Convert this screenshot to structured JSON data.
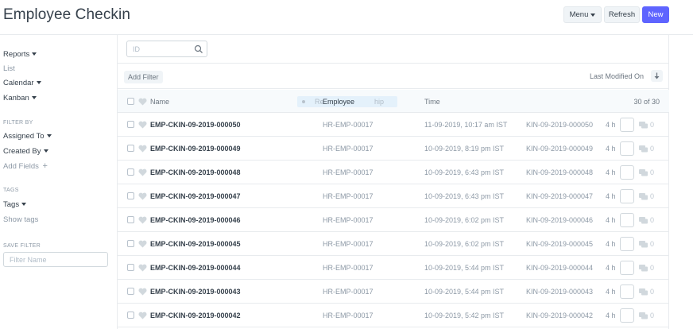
{
  "header": {
    "title": "Employee Checkin",
    "menu_label": "Menu",
    "refresh_label": "Refresh",
    "new_label": "New"
  },
  "sidebar": {
    "reports": "Reports",
    "list": "List",
    "calendar": "Calendar",
    "kanban": "Kanban",
    "filter_by": "FILTER BY",
    "assigned_to": "Assigned To",
    "created_by": "Created By",
    "add_fields": "Add Fields",
    "tags_section": "TAGS",
    "tags": "Tags",
    "show_tags": "Show tags",
    "save_filter": "SAVE FILTER",
    "filter_name_placeholder": "Filter Name"
  },
  "toolbar": {
    "id_placeholder": "ID",
    "add_filter": "Add Filter",
    "sort_label": "Last Modified On"
  },
  "list": {
    "col_name": "Name",
    "drag_chip": "Re",
    "col_employee": "Employee",
    "drag_chip_tail": "hip",
    "col_time": "Time",
    "count": "30 of 30",
    "rows": [
      {
        "name": "EMP-CKIN-09-2019-000050",
        "employee": "HR-EMP-00017",
        "time": "11-09-2019, 10:17 am IST",
        "ref": "KIN-09-2019-000050",
        "modified": "4 h",
        "comments": "0"
      },
      {
        "name": "EMP-CKIN-09-2019-000049",
        "employee": "HR-EMP-00017",
        "time": "10-09-2019, 8:19 pm IST",
        "ref": "KIN-09-2019-000049",
        "modified": "4 h",
        "comments": "0"
      },
      {
        "name": "EMP-CKIN-09-2019-000048",
        "employee": "HR-EMP-00017",
        "time": "10-09-2019, 6:43 pm IST",
        "ref": "KIN-09-2019-000048",
        "modified": "4 h",
        "comments": "0"
      },
      {
        "name": "EMP-CKIN-09-2019-000047",
        "employee": "HR-EMP-00017",
        "time": "10-09-2019, 6:43 pm IST",
        "ref": "KIN-09-2019-000047",
        "modified": "4 h",
        "comments": "0"
      },
      {
        "name": "EMP-CKIN-09-2019-000046",
        "employee": "HR-EMP-00017",
        "time": "10-09-2019, 6:02 pm IST",
        "ref": "KIN-09-2019-000046",
        "modified": "4 h",
        "comments": "0"
      },
      {
        "name": "EMP-CKIN-09-2019-000045",
        "employee": "HR-EMP-00017",
        "time": "10-09-2019, 6:02 pm IST",
        "ref": "KIN-09-2019-000045",
        "modified": "4 h",
        "comments": "0"
      },
      {
        "name": "EMP-CKIN-09-2019-000044",
        "employee": "HR-EMP-00017",
        "time": "10-09-2019, 5:44 pm IST",
        "ref": "KIN-09-2019-000044",
        "modified": "4 h",
        "comments": "0"
      },
      {
        "name": "EMP-CKIN-09-2019-000043",
        "employee": "HR-EMP-00017",
        "time": "10-09-2019, 5:44 pm IST",
        "ref": "KIN-09-2019-000043",
        "modified": "4 h",
        "comments": "0"
      },
      {
        "name": "EMP-CKIN-09-2019-000042",
        "employee": "HR-EMP-00017",
        "time": "10-09-2019, 5:42 pm IST",
        "ref": "KIN-09-2019-000042",
        "modified": "4 h",
        "comments": "0"
      }
    ]
  },
  "colors": {
    "primary": "#5e64ff",
    "text": "#36414c",
    "muted": "#8d99a6",
    "border": "#e8ebee"
  }
}
